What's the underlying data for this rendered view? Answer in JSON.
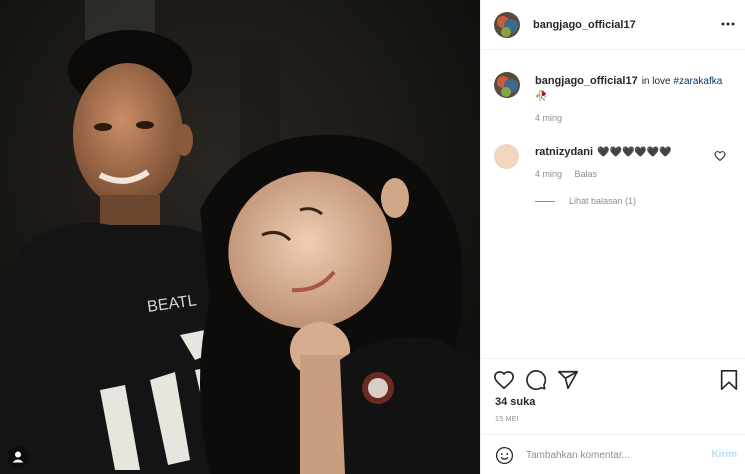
{
  "post": {
    "photo_icon": "person-tag-icon",
    "colors": {
      "hashtag": "#00376b",
      "secondary_text": "#8e8e8e",
      "post_button_disabled": "#b2dffc",
      "border": "#efefef"
    }
  },
  "header": {
    "username": "bangjago_official17",
    "more_icon": "more-options-icon"
  },
  "caption": {
    "username": "bangjago_official17",
    "text": "in love",
    "hashtag": "#zarakafka",
    "emoji": "🥀",
    "time": "4 ming"
  },
  "comments": [
    {
      "username": "ratnizydani",
      "text": "🖤🖤🖤🖤🖤🖤",
      "time": "4 ming",
      "reply_label": "Balas",
      "view_replies": "Lihat balasan (1)",
      "like_icon": "heart-icon"
    }
  ],
  "actions": {
    "icons": [
      "heart-icon",
      "comment-icon",
      "share-icon",
      "bookmark-icon"
    ],
    "likes": "34 suka",
    "date": "15 MEI"
  },
  "add_comment": {
    "placeholder": "Tambahkan komentar...",
    "post_label": "Kirim",
    "emoji_icon": "emoji-icon"
  }
}
